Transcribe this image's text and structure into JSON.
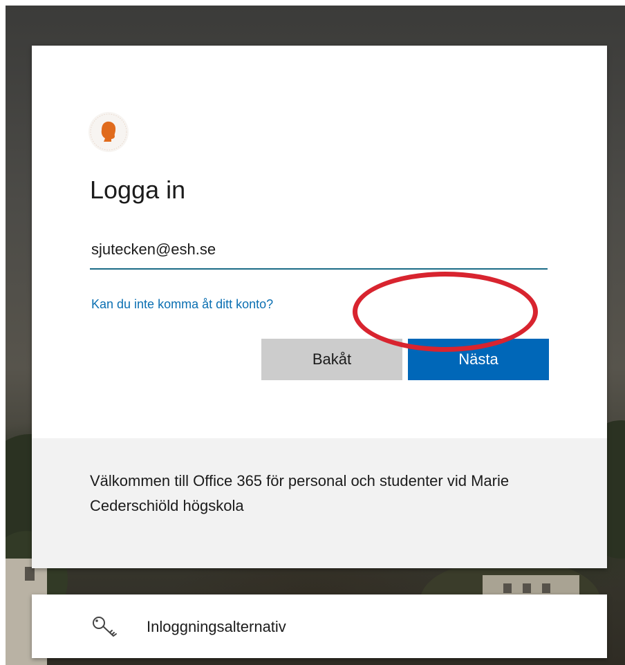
{
  "header": {
    "logo_icon": "school-portrait-logo-icon",
    "logo_color": "#e06b1d"
  },
  "signin": {
    "title": "Logga in",
    "email_value": "sjutecken@esh.se",
    "help_link": "Kan du inte komma åt ditt konto?",
    "back_label": "Bakåt",
    "next_label": "Nästa"
  },
  "footer": {
    "welcome_text": "Välkommen till Office 365 för personal och studenter vid Marie Cederschiöld högskola"
  },
  "options": {
    "icon": "key-icon",
    "label": "Inloggningsalternativ"
  },
  "colors": {
    "accent": "#0067b8",
    "link": "#0a6fb2",
    "highlight": "#d8242f"
  }
}
